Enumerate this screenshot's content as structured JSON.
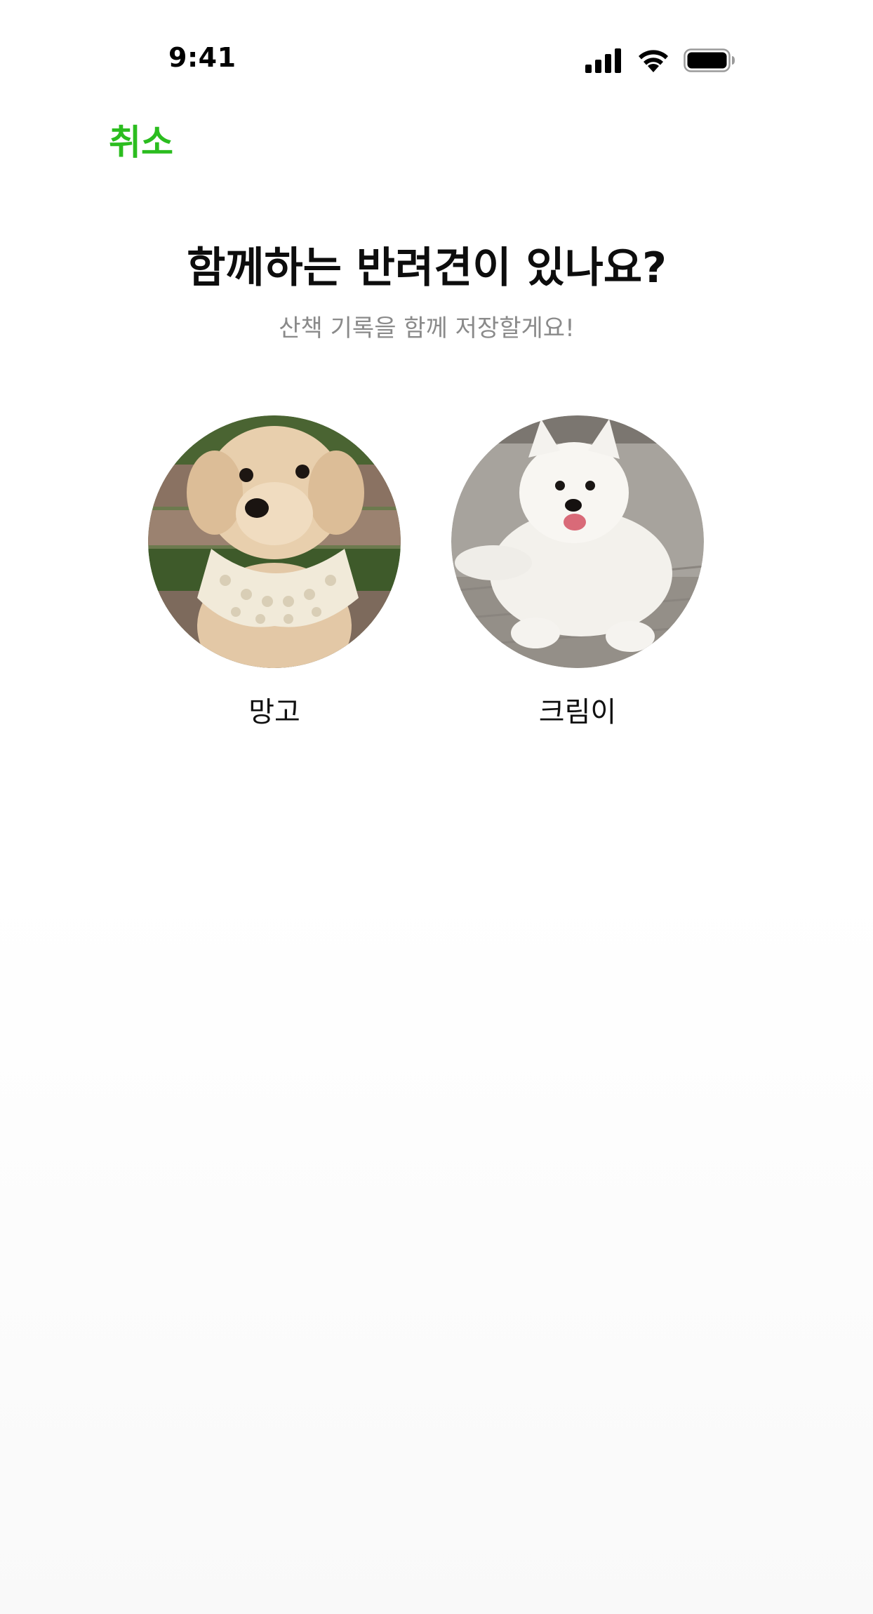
{
  "status_bar": {
    "time": "9:41",
    "icons": [
      "signal-icon",
      "wifi-icon",
      "battery-icon"
    ]
  },
  "header": {
    "cancel_label": "취소",
    "accent_color": "#2bbd1f"
  },
  "main": {
    "title": "함께하는 반려견이 있나요?",
    "subtitle": "산책 기록을 함께 저장할게요!"
  },
  "pets": [
    {
      "name": "망고"
    },
    {
      "name": "크림이"
    }
  ]
}
